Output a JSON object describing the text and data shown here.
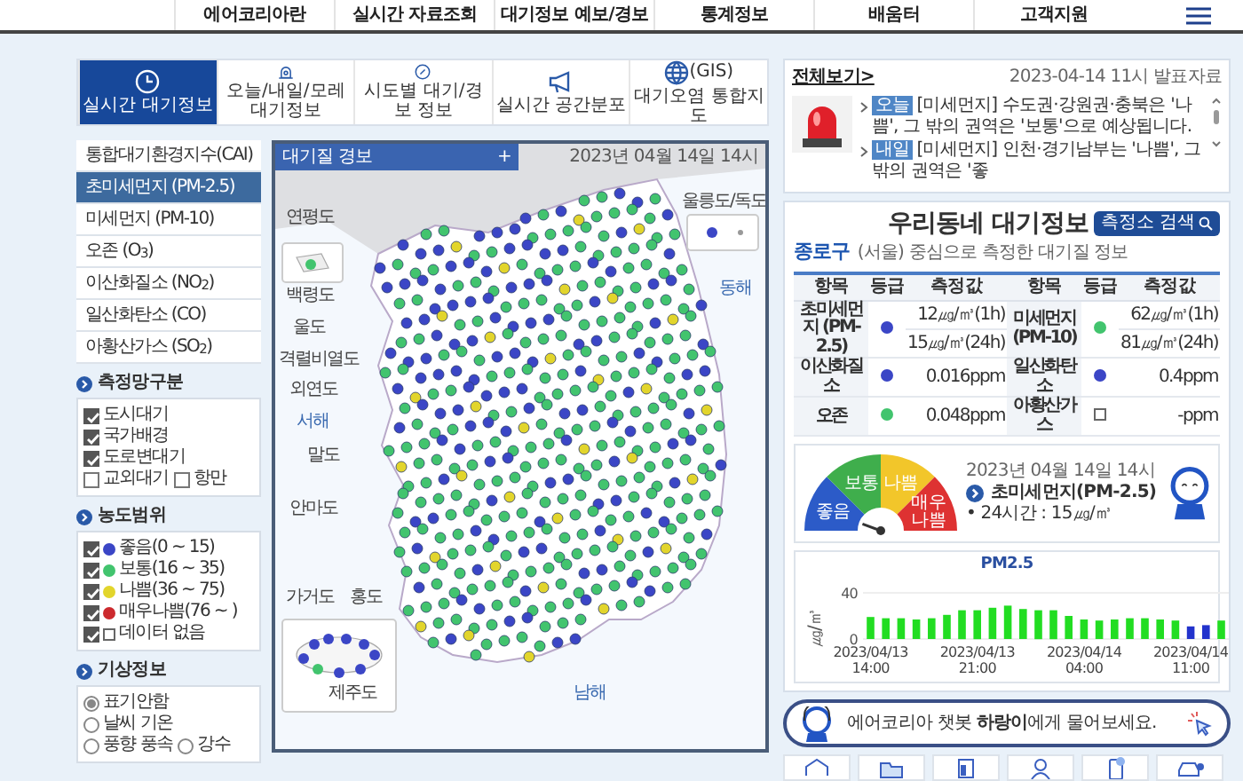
{
  "top_menu": {
    "items": [
      "에어코리아란",
      "실시간 자료조회",
      "대기정보 예보/경보",
      "통계정보",
      "배움터",
      "고객지원"
    ]
  },
  "tabs": [
    {
      "label": "실시간 대기정보",
      "selected": true
    },
    {
      "label": "오늘/내일/모레 대기정보",
      "selected": false
    },
    {
      "label": "시도별 대기/경보 정보",
      "selected": false
    },
    {
      "label": "실시간 공간분포",
      "selected": false
    },
    {
      "label": "대기오염 통합지도",
      "badge": "(GIS)",
      "selected": false
    }
  ],
  "sidebar": {
    "items": [
      {
        "label": "통합대기환경지수(CAI)",
        "selected": false
      },
      {
        "label": "초미세먼지 (PM-2.5)",
        "selected": true
      },
      {
        "label": "미세먼지 (PM-10)",
        "selected": false
      },
      {
        "label": "오존 (O$_{3}$)",
        "selected": false
      },
      {
        "label": "이산화질소 (NO$_{2}$)",
        "selected": false
      },
      {
        "label": "일산화탄소 (CO)",
        "selected": false
      },
      {
        "label": "아황산가스 (SO$_{2}$)",
        "selected": false
      }
    ]
  },
  "station_types": {
    "title": "측정망구분",
    "options": [
      {
        "label": "도시대기",
        "checked": true
      },
      {
        "label": "국가배경",
        "checked": true
      },
      {
        "label": "도로변대기",
        "checked": true
      },
      {
        "label": "교외대기",
        "checked": false
      },
      {
        "label": "항만",
        "checked": false
      }
    ]
  },
  "ranges": {
    "title": "농도범위",
    "items": [
      {
        "label": "좋음(0 ~ 15)",
        "checked": true,
        "kind": "dot",
        "color": "#3b46c6"
      },
      {
        "label": "보통(16 ~ 35)",
        "checked": true,
        "kind": "dot",
        "color": "#42c46e"
      },
      {
        "label": "나쁨(36 ~ 75)",
        "checked": true,
        "kind": "dot",
        "color": "#e2d52c"
      },
      {
        "label": "매우나쁨(76 ~ )",
        "checked": true,
        "kind": "dot",
        "color": "#cc2a2e"
      },
      {
        "label": "데이터 없음",
        "checked": true,
        "kind": "square"
      }
    ]
  },
  "weather": {
    "title": "기상정보",
    "options": [
      {
        "label": "표기안함",
        "selected": true
      },
      {
        "label": "날씨 기온",
        "selected": false
      },
      {
        "label": "풍향 풍속",
        "selected": false
      },
      {
        "label": "강수",
        "selected": false
      }
    ]
  },
  "map": {
    "title": "대기질 경보",
    "expand": "+",
    "date": "2023년 04월 14일 14시",
    "labels": [
      {
        "text": "울릉도/독도",
        "kind": "island"
      },
      {
        "text": "동해",
        "kind": "sea"
      },
      {
        "text": "연평도",
        "kind": "island"
      },
      {
        "text": "백령도",
        "kind": "island"
      },
      {
        "text": "울도",
        "kind": "island"
      },
      {
        "text": "격렬비열도",
        "kind": "island"
      },
      {
        "text": "외연도",
        "kind": "island"
      },
      {
        "text": "서해",
        "kind": "sea"
      },
      {
        "text": "말도",
        "kind": "island"
      },
      {
        "text": "안마도",
        "kind": "island"
      },
      {
        "text": "가거도",
        "kind": "island"
      },
      {
        "text": "홍도",
        "kind": "island"
      },
      {
        "text": "제주도",
        "kind": "island"
      },
      {
        "text": "남해",
        "kind": "sea"
      }
    ]
  },
  "notice": {
    "link": "전체보기>",
    "date": "2023-04-14 11시 발표자료",
    "items": [
      {
        "tag": "오늘",
        "text": "[미세먼지] 수도권·강원권·충북은 '나쁨', 그 밖의 권역은 '보통'으로 예상됩니다."
      },
      {
        "tag": "내일",
        "text": "[미세먼지] 인천·경기남부는 '나쁨', 그 밖의 권역은 '좋"
      }
    ]
  },
  "neighborhood": {
    "title": "우리동네 **대기정보**",
    "search_button": "측정소 검색",
    "district": "종로구",
    "district_note": "(서울) 중심으로 측정한 대기질 정보",
    "columns": [
      "항목",
      "등급",
      "측정값",
      "항목",
      "등급",
      "측정값"
    ],
    "rows": [
      {
        "cells": [
          {
            "item": "초미세먼지 (PM-2.5)",
            "grade": {
              "kind": "dot",
              "color": "#3b46c6"
            },
            "values": [
              "12㎍/㎥(1h)",
              "15㎍/㎥(24h)"
            ]
          },
          {
            "item": "미세먼지 (PM-10)",
            "grade": {
              "kind": "dot",
              "color": "#42c46e"
            },
            "values": [
              "62㎍/㎥(1h)",
              "81㎍/㎥(24h)"
            ]
          }
        ]
      },
      {
        "cells": [
          {
            "item": "이산화질소",
            "grade": {
              "kind": "dot",
              "color": "#3b46c6"
            },
            "values": [
              "0.016ppm"
            ]
          },
          {
            "item": "일산화탄소",
            "grade": {
              "kind": "dot",
              "color": "#3b46c6"
            },
            "values": [
              "0.4ppm"
            ]
          }
        ]
      },
      {
        "cells": [
          {
            "item": "오존",
            "grade": {
              "kind": "dot",
              "color": "#42c46e"
            },
            "values": [
              "0.048ppm"
            ]
          },
          {
            "item": "아황산가스",
            "grade": {
              "kind": "square"
            },
            "values": [
              "-ppm"
            ]
          }
        ]
      }
    ]
  },
  "gauge": {
    "segments": [
      {
        "label": "좋음",
        "color": "#2c5bc8"
      },
      {
        "label": "보통",
        "color": "#3fae4c"
      },
      {
        "label": "나쁨",
        "color": "#f2c62a"
      },
      {
        "label": "매우 나쁨",
        "color": "#de3232"
      }
    ],
    "date": "2023년 04월 14일 14시",
    "title": "초미세먼지(PM-2.5)",
    "reading": "• 24시간 : 15㎍/㎥"
  },
  "chart": {
    "chart_data": {
      "type": "bar",
      "title": "PM2.5",
      "ylabel": "㎍/㎥",
      "ylim": [
        0,
        40
      ],
      "yticks": [
        0,
        40
      ],
      "categories": [
        "2023/04/13 14:00",
        null,
        null,
        null,
        null,
        null,
        null,
        "2023/04/13 21:00",
        null,
        null,
        null,
        null,
        null,
        null,
        "2023/04/14 04:00",
        null,
        null,
        null,
        null,
        null,
        null,
        "2023/04/14 11:00",
        null,
        null
      ],
      "series": [
        {
          "color": "#22dd22",
          "values": [
            19,
            18,
            18,
            17,
            18,
            21,
            25,
            25,
            27,
            29,
            26,
            25,
            25,
            20,
            17,
            16,
            17,
            18,
            18,
            17,
            16,
            null,
            null,
            16
          ]
        },
        {
          "color": "#2233cc",
          "values": [
            null,
            null,
            null,
            null,
            null,
            null,
            null,
            null,
            null,
            null,
            null,
            null,
            null,
            null,
            null,
            null,
            null,
            null,
            null,
            null,
            null,
            11,
            12,
            null
          ]
        }
      ]
    }
  },
  "chatbot": {
    "text": "에어코리아 챗봇 **하랑이**에게 물어보세요."
  }
}
